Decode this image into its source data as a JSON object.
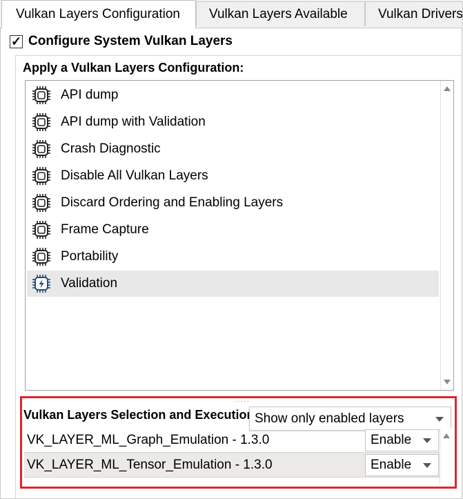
{
  "tabs": [
    {
      "label": "Vulkan Layers Configuration",
      "active": true
    },
    {
      "label": "Vulkan Layers Available",
      "active": false
    },
    {
      "label": "Vulkan Drivers",
      "active": false
    }
  ],
  "system": {
    "checkbox_label": "Configure System Vulkan Layers",
    "checked": true,
    "check_glyph": "✓"
  },
  "apply": {
    "title": "Apply a Vulkan Layers Configuration:",
    "items": [
      {
        "label": "API dump",
        "icon": "chip-icon"
      },
      {
        "label": "API dump with Validation",
        "icon": "chip-icon"
      },
      {
        "label": "Crash Diagnostic",
        "icon": "chip-icon"
      },
      {
        "label": "Disable All Vulkan Layers",
        "icon": "chip-icon"
      },
      {
        "label": "Discard Ordering and Enabling Layers",
        "icon": "chip-icon"
      },
      {
        "label": "Frame Capture",
        "icon": "chip-icon"
      },
      {
        "label": "Portability",
        "icon": "chip-icon"
      },
      {
        "label": "Validation",
        "icon": "chip-lightning-icon",
        "selected": true
      }
    ]
  },
  "selection": {
    "title": "Vulkan Layers Selection and Execution",
    "filter": {
      "value": "Show only enabled layers"
    },
    "layers": [
      {
        "name": "VK_LAYER_ML_Graph_Emulation - 1.3.0",
        "state": "Enable"
      },
      {
        "name": "VK_LAYER_ML_Tensor_Emulation - 1.3.0",
        "state": "Enable"
      }
    ]
  },
  "colors": {
    "highlight_border": "#e0252b",
    "selected_icon": "#1f4f7a",
    "icon": "#222222"
  }
}
